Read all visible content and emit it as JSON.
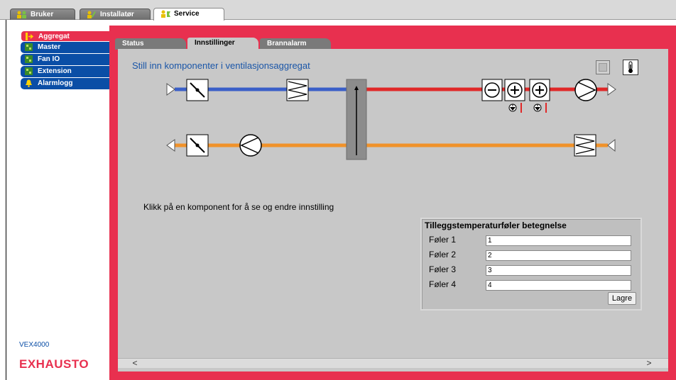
{
  "top_tabs": [
    {
      "label": "Bruker",
      "icon": "users-icon"
    },
    {
      "label": "Installatør",
      "icon": "installer-icon"
    },
    {
      "label": "Service",
      "icon": "service-icon",
      "active": true
    }
  ],
  "sidebar": {
    "items": [
      {
        "label": "Aggregat",
        "icon": "unit-icon",
        "active": true
      },
      {
        "label": "Master",
        "icon": "module-icon"
      },
      {
        "label": "Fan IO",
        "icon": "module-icon"
      },
      {
        "label": "Extension",
        "icon": "module-icon"
      },
      {
        "label": "Alarmlogg",
        "icon": "bell-icon"
      }
    ],
    "model": "VEX4000",
    "brand": "EXHAUSTO"
  },
  "sub_tabs": [
    {
      "label": "Status"
    },
    {
      "label": "Innstillinger",
      "active": true
    },
    {
      "label": "Brannalarm"
    }
  ],
  "main": {
    "heading": "Still inn komponenter i ventilasjonsaggregat",
    "hint": "Klikk på en komponent for å se og endre innstilling"
  },
  "sensors": {
    "title": "Tilleggstemperaturføler betegnelse",
    "rows": [
      {
        "label": "Føler 1",
        "value": "1"
      },
      {
        "label": "Føler 2",
        "value": "2"
      },
      {
        "label": "Føler 3",
        "value": "3"
      },
      {
        "label": "Føler 4",
        "value": "4"
      }
    ],
    "save_label": "Lagre"
  },
  "scroll": {
    "left": "<",
    "right": ">"
  },
  "colors": {
    "accent_red": "#e8304f",
    "nav_blue": "#0a4ea6",
    "supply_cold": "#3a5fc8",
    "supply_warm": "#e02828",
    "extract_orange": "#f0922a"
  }
}
